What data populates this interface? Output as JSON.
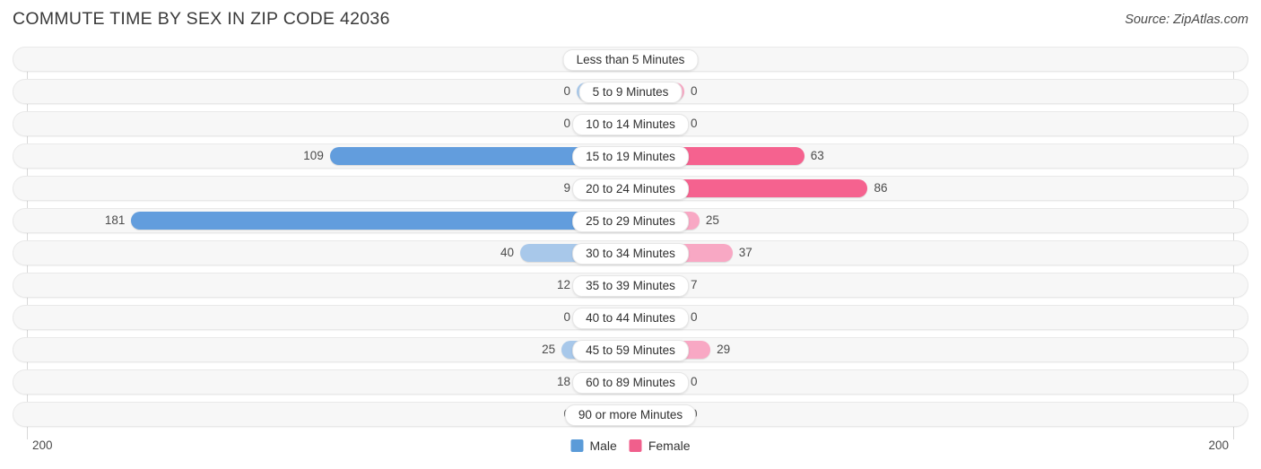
{
  "header": {
    "title": "COMMUTE TIME BY SEX IN ZIP CODE 42036",
    "source": "Source: ZipAtlas.com"
  },
  "footer": {
    "axis_left": "200",
    "axis_right": "200",
    "legend": [
      {
        "label": "Male",
        "color": "#5b9bd8"
      },
      {
        "label": "Female",
        "color": "#f05f8c"
      }
    ]
  },
  "colors": {
    "male_strong": "#629ddd",
    "male_light": "#a8c8ea",
    "female_strong": "#f5628f",
    "female_light": "#f8a8c4",
    "track": "#f7f7f7",
    "track_border": "#e9e9e9",
    "axis": "#d8d8d8"
  },
  "chart_data": {
    "type": "bar",
    "orientation": "horizontal",
    "layout": "diverging-bidirectional",
    "title": "COMMUTE TIME BY SEX IN ZIP CODE 42036",
    "xlabel": "",
    "ylabel": "",
    "xlim": [
      200,
      200
    ],
    "axis_max": 200,
    "grid": false,
    "legend_position": "bottom-center",
    "categories": [
      "Less than 5 Minutes",
      "5 to 9 Minutes",
      "10 to 14 Minutes",
      "15 to 19 Minutes",
      "20 to 24 Minutes",
      "25 to 29 Minutes",
      "30 to 34 Minutes",
      "35 to 39 Minutes",
      "40 to 44 Minutes",
      "45 to 59 Minutes",
      "60 to 89 Minutes",
      "90 or more Minutes"
    ],
    "series": [
      {
        "name": "Male",
        "color": "#5b9bd8",
        "values": [
          0,
          0,
          0,
          109,
          9,
          181,
          40,
          12,
          0,
          25,
          18,
          0
        ]
      },
      {
        "name": "Female",
        "color": "#f05f8c",
        "values": [
          0,
          0,
          0,
          63,
          86,
          25,
          37,
          7,
          0,
          29,
          0,
          0
        ]
      }
    ]
  }
}
